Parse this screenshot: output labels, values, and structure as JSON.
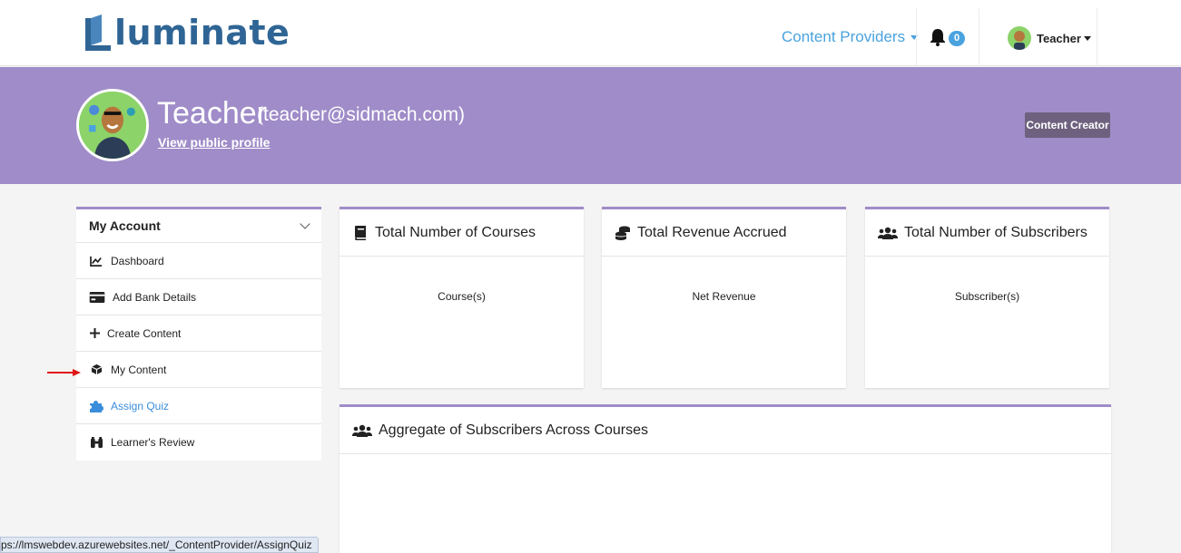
{
  "brand": {
    "logo_text": "luminate",
    "logo_color": "#2f6595"
  },
  "topnav": {
    "providers_label": "Content Providers",
    "notifications_count": "0",
    "user_label": "Teacher"
  },
  "profile": {
    "name": "Teacher",
    "email": "(teacher@sidmach.com)",
    "public_link": "View public profile",
    "role_badge": "Content Creator",
    "banner_color": "#9f8cc8"
  },
  "sidebar": {
    "title": "My Account",
    "items": [
      {
        "label": "Dashboard",
        "icon": "chart-line-icon"
      },
      {
        "label": "Add Bank Details",
        "icon": "credit-card-icon"
      },
      {
        "label": "Create Content",
        "icon": "plus-icon"
      },
      {
        "label": "My Content",
        "icon": "cube-icon"
      },
      {
        "label": "Assign Quiz",
        "icon": "puzzle-icon"
      },
      {
        "label": "Learner's Review",
        "icon": "binoculars-icon"
      }
    ]
  },
  "cards": {
    "courses": {
      "title": "Total Number of Courses",
      "subtitle": "Course(s)",
      "icon": "book-icon"
    },
    "revenue": {
      "title": "Total Revenue Accrued",
      "subtitle": "Net Revenue",
      "icon": "coins-icon"
    },
    "subscribers": {
      "title": "Total Number of Subscribers",
      "subtitle": "Subscriber(s)",
      "icon": "users-icon"
    },
    "aggregate": {
      "title": "Aggregate of Subscribers Across Courses",
      "icon": "users-icon"
    }
  },
  "status_url": "ps://lmswebdev.azurewebsites.net/_ContentProvider/AssignQuiz",
  "colors": {
    "accent": "#4aa3df",
    "link_active": "#3a8ddb"
  }
}
